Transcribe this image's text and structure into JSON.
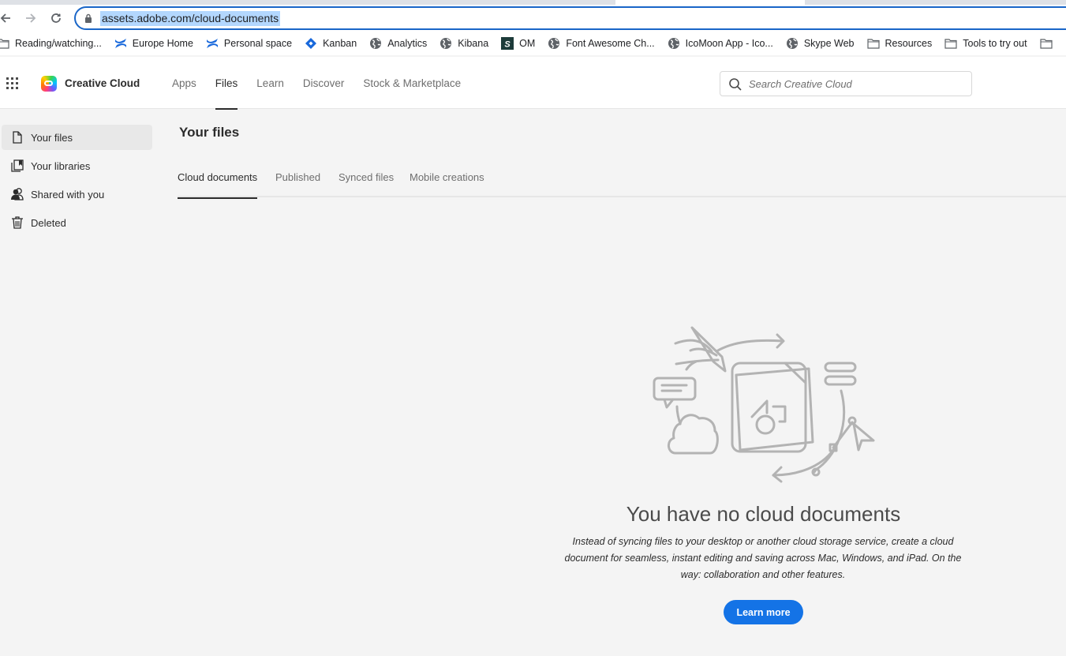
{
  "browser": {
    "url": "assets.adobe.com/cloud-documents",
    "bookmarks": [
      {
        "label": "Reading/watching...",
        "icon": "folder-icon"
      },
      {
        "label": "Europe Home",
        "icon": "confluence-icon"
      },
      {
        "label": "Personal space",
        "icon": "confluence-icon"
      },
      {
        "label": "Kanban",
        "icon": "jira-diamond-icon"
      },
      {
        "label": "Analytics",
        "icon": "globe-icon"
      },
      {
        "label": "Kibana",
        "icon": "globe-icon"
      },
      {
        "label": "OM",
        "icon": "s-badge-icon"
      },
      {
        "label": "Font Awesome Ch...",
        "icon": "globe-icon"
      },
      {
        "label": "IcoMoon App - Ico...",
        "icon": "globe-icon"
      },
      {
        "label": "Skype Web",
        "icon": "globe-icon"
      },
      {
        "label": "Resources",
        "icon": "folder-icon"
      },
      {
        "label": "Tools to try out",
        "icon": "folder-icon"
      }
    ]
  },
  "app": {
    "brand": "Creative Cloud",
    "nav": [
      {
        "label": "Apps",
        "active": false
      },
      {
        "label": "Files",
        "active": true
      },
      {
        "label": "Learn",
        "active": false
      },
      {
        "label": "Discover",
        "active": false
      },
      {
        "label": "Stock & Marketplace",
        "active": false
      }
    ],
    "search_placeholder": "Search Creative Cloud"
  },
  "sidebar": {
    "items": [
      {
        "label": "Your files",
        "icon": "file-icon",
        "active": true
      },
      {
        "label": "Your libraries",
        "icon": "libraries-icon",
        "active": false
      },
      {
        "label": "Shared with you",
        "icon": "users-icon",
        "active": false
      },
      {
        "label": "Deleted",
        "icon": "trash-icon",
        "active": false
      }
    ]
  },
  "main": {
    "title": "Your files",
    "tabs": [
      {
        "label": "Cloud documents",
        "active": true
      },
      {
        "label": "Published",
        "active": false
      },
      {
        "label": "Synced files",
        "active": false
      },
      {
        "label": "Mobile creations",
        "active": false
      }
    ],
    "empty_state": {
      "title": "You have no cloud documents",
      "description": "Instead of syncing files to your desktop or another cloud storage service, create a cloud document for seamless, instant editing and saving across Mac, Windows, and iPad. On the way: collaboration and other features.",
      "button": "Learn more"
    }
  },
  "colors": {
    "accent": "#1473e6",
    "omnibox_focus": "#1a66c8",
    "url_selection": "#b3d7fe",
    "page_bg": "#f4f4f4",
    "illustration": "#b3b3b3"
  }
}
